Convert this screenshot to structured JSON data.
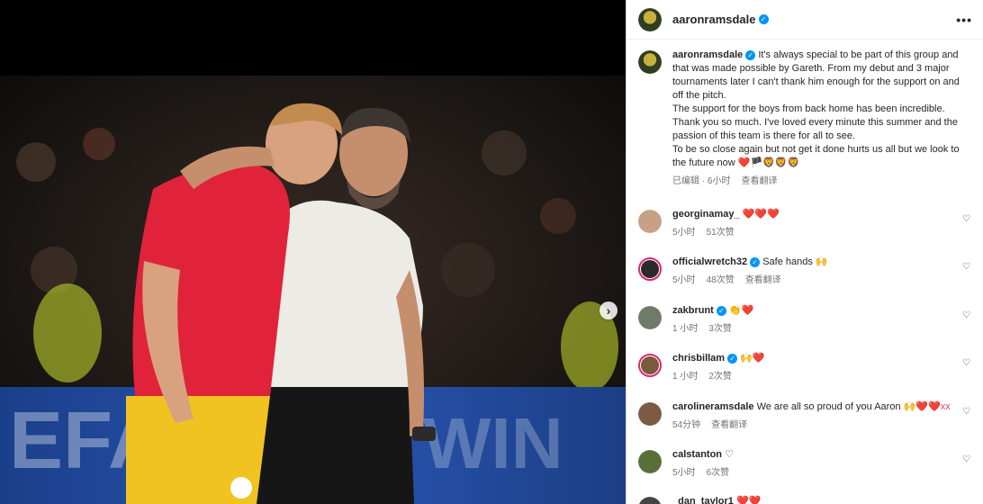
{
  "post": {
    "author": "aaronramsdale",
    "more_icon": "more-horizontal-icon",
    "caption": {
      "line1": "It's always special to be part of this group and that was made possible by Gareth. From my debut and 3 major tournaments later I can't thank him enough for the support on and off the pitch.",
      "line2": "The support for the boys from back home has been incredible. Thank you so much. I've loved every minute this summer and the passion of this team is there for all to see.",
      "line3": "To be so close again but not get it done hurts us all but we look to the future now",
      "emojis": "❤️🏴🦁🦁🦁",
      "edited": "已编辑 · 6小时",
      "translate": "查看翻译"
    }
  },
  "comments": [
    {
      "user": "georginamay_",
      "verified": false,
      "text": "",
      "emoji": "❤️❤️❤️",
      "time": "5小时",
      "likes": "51次赞",
      "translate": ""
    },
    {
      "user": "officialwretch32",
      "verified": true,
      "text": "Safe hands",
      "emoji": "🙌",
      "time": "5小时",
      "likes": "48次赞",
      "translate": "查看翻译"
    },
    {
      "user": "zakbrunt",
      "verified": true,
      "text": "",
      "emoji": "👏❤️",
      "time": "1 小时",
      "likes": "3次赞",
      "translate": ""
    },
    {
      "user": "chrisbillam",
      "verified": true,
      "text": "",
      "emoji": "🙌❤️",
      "time": "1 小时",
      "likes": "2次赞",
      "translate": ""
    },
    {
      "user": "carolineramsdale",
      "verified": false,
      "text": "We are all so proud of you Aaron",
      "emoji": "🙌❤️❤️xx",
      "time": "54分钟",
      "likes": "",
      "translate": "查看翻译"
    },
    {
      "user": "calstanton",
      "verified": false,
      "text": "",
      "emoji": "♡",
      "time": "5小时",
      "likes": "6次赞",
      "translate": ""
    },
    {
      "user": "_dan_taylor1",
      "verified": false,
      "text": "",
      "emoji": "❤️❤️",
      "time": "",
      "likes": "",
      "translate": ""
    }
  ],
  "colors": {
    "accent": "#0095f6",
    "heart_red": "#ed4956",
    "story_ring": "#d62976"
  }
}
